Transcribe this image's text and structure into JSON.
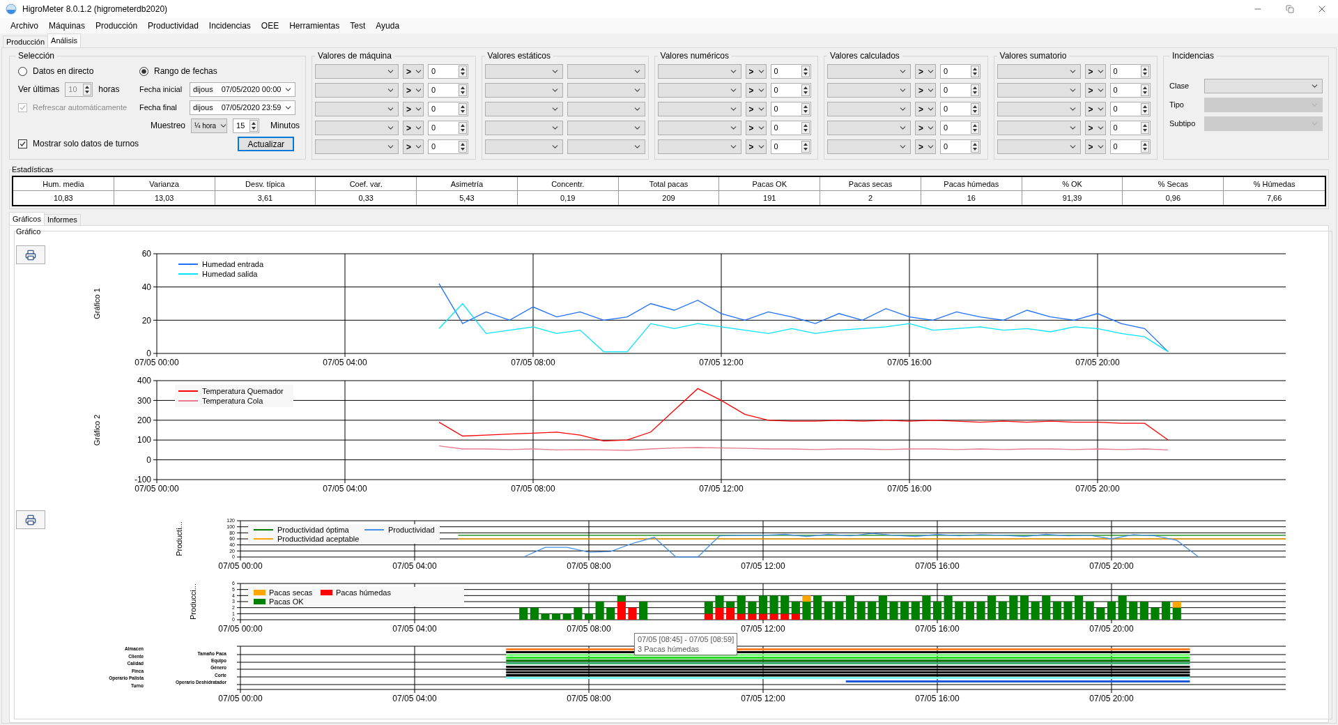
{
  "window": {
    "title": "HigroMeter 8.0.1.2 (higrometerdb2020)"
  },
  "menu": [
    "Archivo",
    "Máquinas",
    "Producción",
    "Productividad",
    "Incidencias",
    "OEE",
    "Herramientas",
    "Test",
    "Ayuda"
  ],
  "tabs": [
    {
      "label": "Producción",
      "selected": false
    },
    {
      "label": "Análisis",
      "selected": true
    }
  ],
  "selection": {
    "title": "Selección",
    "modes": [
      {
        "label": "Datos en directo",
        "selected": false
      },
      {
        "label": "Rango de fechas",
        "selected": true
      }
    ],
    "last_hours": {
      "label": "Ver últimas",
      "value": "10",
      "unit": "horas",
      "disabled": true
    },
    "auto_refresh": {
      "label": "Refrescar automáticamente",
      "checked": true,
      "disabled": true
    },
    "start": {
      "label": "Fecha inicial",
      "day": "dijous",
      "value": "07/05/2020 00:00"
    },
    "end": {
      "label": "Fecha final",
      "day": "dijous",
      "value": "07/05/2020 23:59"
    },
    "sampling": {
      "label": "Muestreo",
      "option": "¼ hora",
      "value": "15",
      "unit": "Minutos"
    },
    "shifts_only": {
      "label": "Mostrar solo datos de turnos",
      "checked": true
    },
    "update_button": "Actualizar"
  },
  "filter_groups": [
    {
      "title": "Valores de máquina",
      "kind": "compare",
      "rows": [
        {
          "operator": ">",
          "value": "0"
        },
        {
          "operator": ">",
          "value": "0"
        },
        {
          "operator": ">",
          "value": "0"
        },
        {
          "operator": ">",
          "value": "0"
        },
        {
          "operator": ">",
          "value": "0"
        }
      ]
    },
    {
      "title": "Valores estáticos",
      "kind": "pair"
    },
    {
      "title": "Valores numéricos",
      "kind": "compare",
      "rows": [
        {
          "operator": ">",
          "value": "0"
        },
        {
          "operator": ">",
          "value": "0"
        },
        {
          "operator": ">",
          "value": "0"
        },
        {
          "operator": ">",
          "value": "0"
        },
        {
          "operator": ">",
          "value": "0"
        }
      ]
    },
    {
      "title": "Valores calculados",
      "kind": "compare",
      "rows": [
        {
          "operator": ">",
          "value": "0"
        },
        {
          "operator": ">",
          "value": "0"
        },
        {
          "operator": ">",
          "value": "0"
        },
        {
          "operator": ">",
          "value": "0"
        },
        {
          "operator": ">",
          "value": "0"
        }
      ]
    },
    {
      "title": "Valores sumatorio",
      "kind": "compare",
      "rows": [
        {
          "operator": ">",
          "value": "0"
        },
        {
          "operator": ">",
          "value": "0"
        },
        {
          "operator": ">",
          "value": "0"
        },
        {
          "operator": ">",
          "value": "0"
        },
        {
          "operator": ">",
          "value": "0"
        }
      ]
    }
  ],
  "incidents": {
    "title": "Incidencias",
    "fields": [
      {
        "label": "Clase",
        "disabled": false
      },
      {
        "label": "Tipo",
        "disabled": true
      },
      {
        "label": "Subtipo",
        "disabled": true
      }
    ]
  },
  "statistics": {
    "title": "Estadísticas",
    "columns": [
      "Hum. media",
      "Varianza",
      "Desv. típica",
      "Coef. var.",
      "Asimetría",
      "Concentr.",
      "Total pacas",
      "Pacas OK",
      "Pacas secas",
      "Pacas húmedas",
      "% OK",
      "% Secas",
      "% Húmedas"
    ],
    "values": [
      "10,83",
      "13,03",
      "3,61",
      "0,33",
      "5,43",
      "0,19",
      "209",
      "191",
      "2",
      "16",
      "91,39",
      "0,96",
      "7,66"
    ]
  },
  "view_tabs": [
    {
      "label": "Gráficos",
      "selected": true
    },
    {
      "label": "Informes",
      "selected": false
    }
  ],
  "graphs": {
    "title": "Gráfico",
    "charts": [
      {
        "chart_data": {
          "type": "line",
          "grid": true,
          "legend": true,
          "ylabel": "Gráfico 1",
          "ylim": [
            0,
            60
          ],
          "yticks": [
            0,
            20,
            40,
            60
          ],
          "categories": [
            "07/05 00:00",
            null,
            null,
            null,
            null,
            null,
            null,
            null,
            "07/05 04:00",
            null,
            null,
            null,
            null,
            null,
            null,
            null,
            "07/05 08:00",
            null,
            null,
            null,
            null,
            null,
            null,
            null,
            "07/05 12:00",
            null,
            null,
            null,
            null,
            null,
            null,
            null,
            "07/05 16:00",
            null,
            null,
            null,
            null,
            null,
            null,
            null,
            "07/05 20:00",
            null,
            null,
            null,
            null,
            null,
            null,
            null,
            null
          ],
          "series": [
            {
              "name": "Humedad entrada",
              "color": "#1e6fff",
              "values": [
                null,
                null,
                null,
                null,
                null,
                null,
                null,
                null,
                null,
                null,
                null,
                null,
                42,
                18,
                25,
                20,
                28,
                22,
                25,
                20,
                22,
                30,
                26,
                32,
                24,
                20,
                25,
                22,
                18,
                24,
                20,
                27,
                22,
                20,
                25,
                22,
                20,
                26,
                22,
                20,
                24,
                18,
                15,
                1,
                null,
                null,
                null,
                null,
                null
              ]
            },
            {
              "name": "Humedad salida",
              "color": "#00e5ff",
              "values": [
                null,
                null,
                null,
                null,
                null,
                null,
                null,
                null,
                null,
                null,
                null,
                null,
                15,
                30,
                12,
                14,
                16,
                12,
                14,
                1,
                1,
                18,
                15,
                18,
                16,
                14,
                12,
                15,
                12,
                14,
                15,
                16,
                18,
                14,
                15,
                16,
                14,
                15,
                13,
                16,
                15,
                12,
                10,
                1,
                null,
                null,
                null,
                null,
                null
              ]
            }
          ]
        }
      },
      {
        "chart_data": {
          "type": "line",
          "grid": true,
          "legend": true,
          "ylabel": "Gráfico 2",
          "ylim": [
            -100,
            400
          ],
          "yticks": [
            -100,
            0,
            100,
            200,
            300,
            400
          ],
          "categories": [
            "07/05 00:00",
            null,
            null,
            null,
            null,
            null,
            null,
            null,
            "07/05 04:00",
            null,
            null,
            null,
            null,
            null,
            null,
            null,
            "07/05 08:00",
            null,
            null,
            null,
            null,
            null,
            null,
            null,
            "07/05 12:00",
            null,
            null,
            null,
            null,
            null,
            null,
            null,
            "07/05 16:00",
            null,
            null,
            null,
            null,
            null,
            null,
            null,
            "07/05 20:00",
            null,
            null,
            null,
            null,
            null,
            null,
            null,
            null
          ],
          "series": [
            {
              "name": "Temperatura Quemador",
              "color": "#ff0000",
              "values": [
                null,
                null,
                null,
                null,
                null,
                null,
                null,
                null,
                null,
                null,
                null,
                null,
                190,
                120,
                125,
                130,
                135,
                140,
                125,
                95,
                100,
                140,
                250,
                360,
                300,
                230,
                200,
                195,
                195,
                200,
                195,
                200,
                195,
                200,
                195,
                190,
                195,
                190,
                195,
                190,
                190,
                185,
                185,
                100,
                null,
                null,
                null,
                null,
                null
              ]
            },
            {
              "name": "Temperatura Cola",
              "color": "#e8798f",
              "values": [
                null,
                null,
                null,
                null,
                null,
                null,
                null,
                null,
                null,
                null,
                null,
                null,
                70,
                55,
                55,
                52,
                55,
                50,
                52,
                50,
                48,
                55,
                60,
                62,
                60,
                58,
                55,
                55,
                52,
                55,
                55,
                52,
                55,
                55,
                52,
                55,
                52,
                55,
                55,
                52,
                55,
                52,
                55,
                50,
                null,
                null,
                null,
                null,
                null
              ]
            }
          ]
        }
      },
      {
        "chart_data": {
          "type": "line",
          "grid": true,
          "legend": true,
          "ylabel": "Producti...",
          "ylim": [
            0,
            120
          ],
          "yticks": [
            0,
            20,
            40,
            60,
            80,
            100,
            120
          ],
          "categories": [
            "07/05 00:00",
            null,
            null,
            null,
            null,
            null,
            null,
            null,
            "07/05 04:00",
            null,
            null,
            null,
            null,
            null,
            null,
            null,
            "07/05 08:00",
            null,
            null,
            null,
            null,
            null,
            null,
            null,
            "07/05 12:00",
            null,
            null,
            null,
            null,
            null,
            null,
            null,
            "07/05 16:00",
            null,
            null,
            null,
            null,
            null,
            null,
            null,
            "07/05 20:00",
            null,
            null,
            null,
            null,
            null,
            null,
            null,
            null
          ],
          "series": [
            {
              "name": "Productividad óptima",
              "color": "#007a00",
              "values": [
                null,
                null,
                null,
                null,
                null,
                null,
                null,
                null,
                null,
                null,
                72,
                72,
                72,
                72,
                72,
                72,
                72,
                72,
                72,
                72,
                72,
                72,
                72,
                72,
                72,
                72,
                72,
                72,
                72,
                72,
                72,
                72,
                72,
                72,
                72,
                72,
                72,
                72,
                72,
                72,
                72,
                72,
                72,
                72,
                72,
                72,
                72,
                72,
                72
              ]
            },
            {
              "name": "Productividad aceptable",
              "color": "#ffa500",
              "values": [
                null,
                null,
                null,
                null,
                null,
                null,
                null,
                null,
                null,
                null,
                60,
                60,
                60,
                60,
                60,
                60,
                60,
                60,
                60,
                60,
                60,
                60,
                60,
                60,
                60,
                60,
                60,
                60,
                60,
                60,
                60,
                60,
                60,
                60,
                60,
                60,
                60,
                60,
                60,
                60,
                60,
                60,
                60,
                60,
                60,
                60,
                60,
                60,
                60
              ]
            },
            {
              "name": "Productividad",
              "color": "#4a90e2",
              "values": [
                null,
                null,
                null,
                null,
                null,
                null,
                null,
                null,
                null,
                null,
                null,
                null,
                null,
                0,
                32,
                32,
                16,
                18,
                45,
                65,
                0,
                0,
                70,
                72,
                72,
                75,
                68,
                75,
                70,
                78,
                72,
                68,
                75,
                70,
                74,
                72,
                68,
                75,
                70,
                72,
                60,
                74,
                70,
                55,
                0,
                null,
                null,
                null,
                null
              ]
            }
          ]
        }
      },
      {
        "chart_data": {
          "type": "bar",
          "grid": true,
          "legend": true,
          "stacked": true,
          "ylabel": "Producci...",
          "ylim": [
            0,
            6
          ],
          "yticks": [
            0,
            1,
            2,
            3,
            4,
            5,
            6
          ],
          "categories": [
            "07/05 00:00",
            null,
            null,
            null,
            null,
            null,
            null,
            null,
            null,
            null,
            null,
            null,
            null,
            null,
            null,
            null,
            "07/05 04:00",
            null,
            null,
            null,
            null,
            null,
            null,
            null,
            null,
            null,
            null,
            null,
            null,
            null,
            null,
            null,
            "07/05 08:00",
            null,
            null,
            null,
            null,
            null,
            null,
            null,
            null,
            null,
            null,
            null,
            null,
            null,
            null,
            null,
            "07/05 12:00",
            null,
            null,
            null,
            null,
            null,
            null,
            null,
            null,
            null,
            null,
            null,
            null,
            null,
            null,
            null,
            "07/05 16:00",
            null,
            null,
            null,
            null,
            null,
            null,
            null,
            null,
            null,
            null,
            null,
            null,
            null,
            null,
            null,
            "07/05 20:00",
            null,
            null,
            null,
            null,
            null,
            null,
            null,
            null,
            null,
            null,
            null,
            null,
            null,
            null,
            null,
            null
          ],
          "series": [
            {
              "name": "Pacas húmedas",
              "color": "#ff0000",
              "values": [
                null,
                null,
                null,
                null,
                null,
                null,
                null,
                null,
                null,
                null,
                null,
                null,
                null,
                null,
                null,
                null,
                null,
                null,
                null,
                null,
                null,
                null,
                null,
                null,
                null,
                null,
                0,
                0,
                0,
                0,
                0,
                0,
                0,
                0,
                0,
                3,
                2,
                0,
                0,
                0,
                0,
                0,
                0,
                1,
                2,
                2,
                1,
                1,
                1,
                1,
                1,
                1,
                0,
                0,
                0,
                0,
                0,
                0,
                0,
                0,
                0,
                0,
                0,
                0,
                0,
                0,
                0,
                0,
                0,
                0,
                0,
                0,
                0,
                0,
                0,
                0,
                0,
                0,
                0,
                0,
                0,
                0,
                0,
                0,
                0,
                0,
                0,
                null,
                null,
                null,
                null,
                null,
                null,
                null,
                null,
                null,
                null
              ]
            },
            {
              "name": "Pacas OK",
              "color": "#008000",
              "values": [
                null,
                null,
                null,
                null,
                null,
                null,
                null,
                null,
                null,
                null,
                null,
                null,
                null,
                null,
                null,
                null,
                null,
                null,
                null,
                null,
                null,
                null,
                null,
                null,
                null,
                null,
                2,
                2,
                1,
                1,
                1,
                2,
                1,
                3,
                2,
                1,
                0,
                3,
                0,
                0,
                0,
                0,
                0,
                2,
                2,
                1,
                3,
                2,
                3,
                3,
                3,
                2,
                3,
                4,
                3,
                3,
                4,
                3,
                3,
                4,
                3,
                3,
                3,
                4,
                3,
                4,
                3,
                3,
                3,
                4,
                3,
                4,
                4,
                3,
                4,
                3,
                3,
                4,
                3,
                2,
                3,
                4,
                3,
                3,
                2,
                3,
                2,
                null,
                null,
                null,
                null,
                null,
                null,
                null,
                null,
                null,
                null
              ]
            },
            {
              "name": "Pacas secas",
              "color": "#ffa500",
              "values": [
                null,
                null,
                null,
                null,
                null,
                null,
                null,
                null,
                null,
                null,
                null,
                null,
                null,
                null,
                null,
                null,
                null,
                null,
                null,
                null,
                null,
                null,
                null,
                null,
                null,
                null,
                0,
                0,
                0,
                0,
                0,
                0,
                0,
                0,
                0,
                0,
                0,
                0,
                0,
                0,
                0,
                0,
                0,
                0,
                0,
                0,
                0,
                0,
                0,
                0,
                0,
                0,
                1,
                0,
                0,
                0,
                0,
                0,
                0,
                0,
                0,
                0,
                0,
                0,
                0,
                0,
                0,
                0,
                0,
                0,
                0,
                0,
                0,
                0,
                0,
                0,
                0,
                0,
                0,
                0,
                0,
                0,
                0,
                0,
                0,
                0,
                1,
                null,
                null,
                null,
                null,
                null,
                null,
                null,
                null,
                null,
                null
              ]
            }
          ]
        }
      }
    ],
    "timeline": {
      "left_labels": [
        "Almacen",
        "Cliente",
        "Calidad",
        "Finca",
        "Operario Palista",
        "Turno"
      ],
      "right_labels": [
        "Tamaño Paca",
        "Equipo",
        "Género",
        "Corte",
        "Operario Deshidratador"
      ],
      "xtick_labels": [
        "07/05 00:00",
        "07/05 04:00",
        "07/05 08:00",
        "07/05 12:00",
        "07/05 16:00",
        "07/05 20:00"
      ]
    },
    "tooltip": {
      "lines": [
        "07/05 [08:45] - 07/05 [08:59]",
        "3 Pacas húmedas"
      ]
    }
  }
}
